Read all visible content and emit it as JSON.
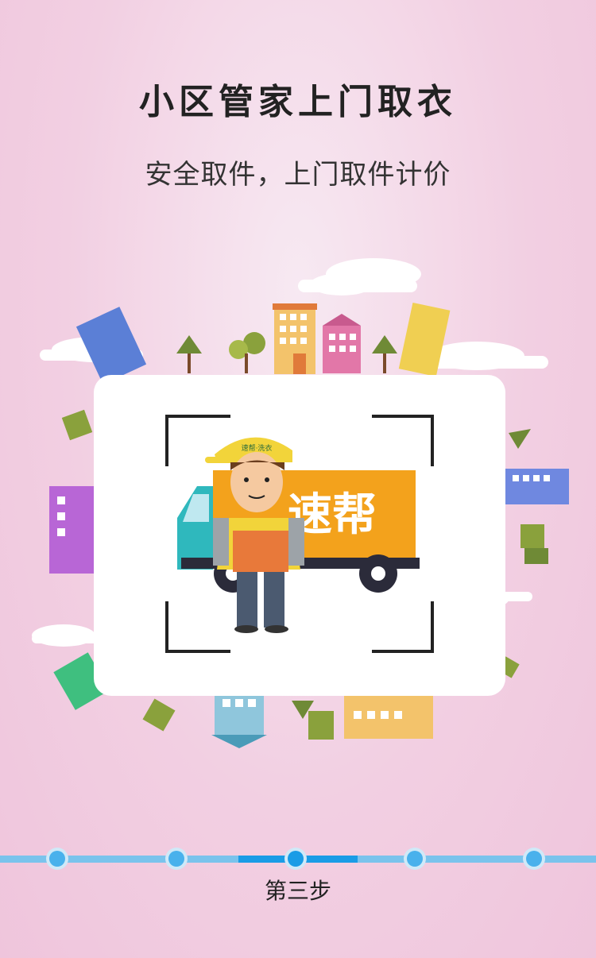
{
  "page": {
    "title": "小区管家上门取衣",
    "subtitle": "安全取件，上门取件计价"
  },
  "illustration": {
    "truck_text": "速帮",
    "cap_text": "速帮·洗衣"
  },
  "progress": {
    "steps": 5,
    "current_step": 3,
    "step_label": "第三步"
  },
  "colors": {
    "background": "#f2cfe2",
    "progress_line": "#7ac3ec",
    "progress_active": "#1a9ce6",
    "truck_orange": "#f3a21c",
    "truck_teal": "#2fb8bd"
  }
}
